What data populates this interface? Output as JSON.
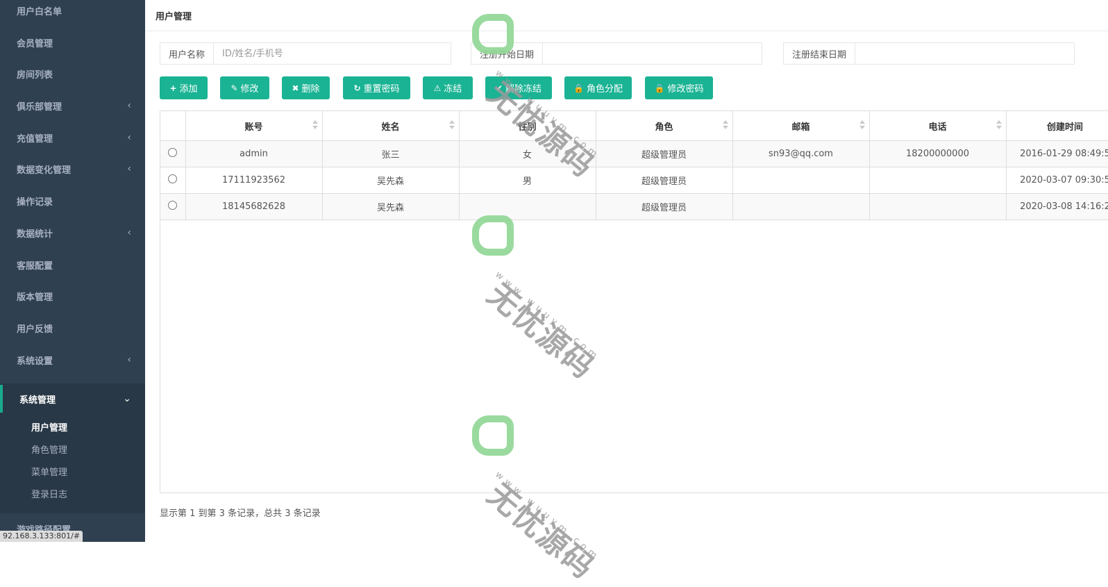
{
  "sidebar": {
    "items": [
      {
        "label": "用户白名单",
        "chevron": ""
      },
      {
        "label": "会员管理",
        "chevron": ""
      },
      {
        "label": "房间列表",
        "chevron": ""
      },
      {
        "label": "俱乐部管理",
        "chevron": "‹"
      },
      {
        "label": "充值管理",
        "chevron": "‹"
      },
      {
        "label": "数据变化管理",
        "chevron": "‹"
      },
      {
        "label": "操作记录",
        "chevron": ""
      },
      {
        "label": "数据统计",
        "chevron": "‹"
      },
      {
        "label": "客服配置",
        "chevron": ""
      },
      {
        "label": "版本管理",
        "chevron": ""
      },
      {
        "label": "用户反馈",
        "chevron": ""
      },
      {
        "label": "系统设置",
        "chevron": "‹"
      }
    ],
    "active_group": {
      "label": "系统管理",
      "chevron": "⌄"
    },
    "sub_items": [
      "用户管理",
      "角色管理",
      "菜单管理",
      "登录日志"
    ],
    "after_item": {
      "label": "游戏路径配置"
    }
  },
  "statusbar": "92.168.3.133:801/#",
  "page": {
    "title": "用户管理"
  },
  "filters": {
    "username": {
      "label": "用户名称",
      "placeholder": "ID/姓名/手机号",
      "value": ""
    },
    "start_date": {
      "label": "注册开始日期",
      "value": ""
    },
    "end_date": {
      "label": "注册结束日期",
      "value": ""
    }
  },
  "toolbar": {
    "add": {
      "icon": "+",
      "label": "添加"
    },
    "edit": {
      "icon": "✎",
      "label": "修改"
    },
    "delete": {
      "icon": "✖",
      "label": "删除"
    },
    "reset_password": {
      "icon": "↻",
      "label": "重置密码"
    },
    "freeze": {
      "icon": "⚠",
      "label": "冻结"
    },
    "unfreeze": {
      "icon": "✔",
      "label": "解除冻结"
    },
    "assign_role": {
      "icon": "🔒",
      "label": "角色分配"
    },
    "change_password": {
      "icon": "🔒",
      "label": "修改密码"
    }
  },
  "table": {
    "columns": [
      "账号",
      "姓名",
      "性别",
      "角色",
      "邮箱",
      "电话",
      "创建时间"
    ],
    "rows": [
      [
        "admin",
        "张三",
        "女",
        "超级管理员",
        "sn93@qq.com",
        "18200000000",
        "2016-01-29 08:49:5"
      ],
      [
        "17111923562",
        "吴先森",
        "男",
        "超级管理员",
        "",
        "",
        "2020-03-07 09:30:5"
      ],
      [
        "18145682628",
        "吴先森",
        "",
        "超级管理员",
        "",
        "",
        "2020-03-08 14:16:2"
      ]
    ]
  },
  "pager": {
    "info": "显示第 1 到第 3 条记录，总共 3 条记录"
  },
  "watermark": {
    "text": "无忧源码",
    "url": "www.wuuym.com"
  },
  "colors": {
    "sidebar_bg": "#2f4050",
    "accent": "#1ab394"
  }
}
